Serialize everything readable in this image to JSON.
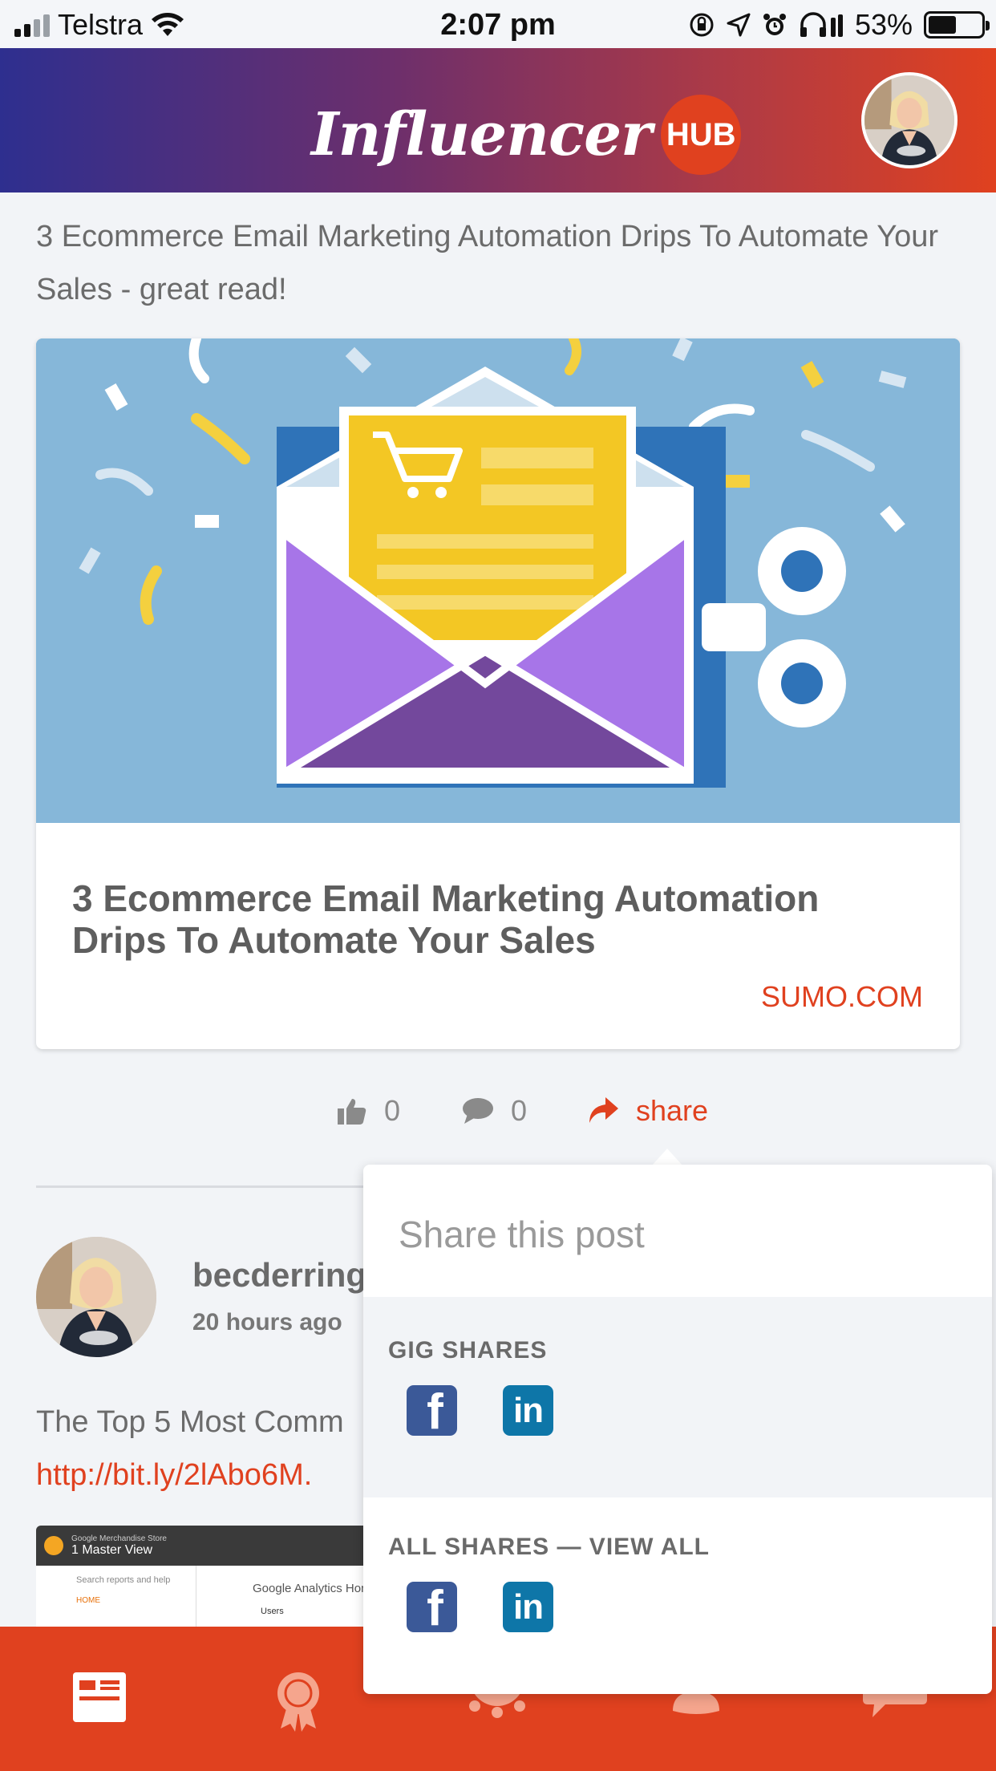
{
  "status_bar": {
    "carrier": "Telstra",
    "time": "2:07 pm",
    "battery_percent": "53%",
    "battery_level": 0.53
  },
  "header": {
    "logo_text": "Influencer",
    "logo_badge": "HUB"
  },
  "post1": {
    "text": "3 Ecommerce Email Marketing Automation Drips To Automate Your Sales - great read!",
    "card_title": "3 Ecommerce Email Marketing Automation Drips To Automate Your Sales",
    "card_source": "SUMO.COM",
    "like_count": "0",
    "comment_count": "0",
    "share_label": "share"
  },
  "post2": {
    "author": "becderring",
    "time_ago": "20 hours ago",
    "text": "The Top 5 Most Comm",
    "link": "http://bit.ly/2lAbo6M.",
    "image": {
      "store": "Google Merchandise Store",
      "view": "1 Master View",
      "search": "Search reports and help",
      "home": "HOME",
      "panel_title": "Google Analytics Hon",
      "tab": "Users"
    }
  },
  "share_popover": {
    "title": "Share this post",
    "gig_shares_label": "GIG SHARES",
    "all_shares_label": "ALL SHARES — VIEW ALL",
    "facebook_glyph": "f",
    "linkedin_glyph": "in"
  },
  "colors": {
    "accent": "#e0411f",
    "header_gradient_start": "#2e2f8f",
    "header_gradient_end": "#e0411f",
    "facebook": "#3b5998",
    "linkedin": "#0e76a8"
  },
  "bottom_nav": {
    "items": [
      "feed-icon",
      "award-icon",
      "gear-icon",
      "profile-icon",
      "chat-icon"
    ],
    "active": "feed-icon"
  }
}
